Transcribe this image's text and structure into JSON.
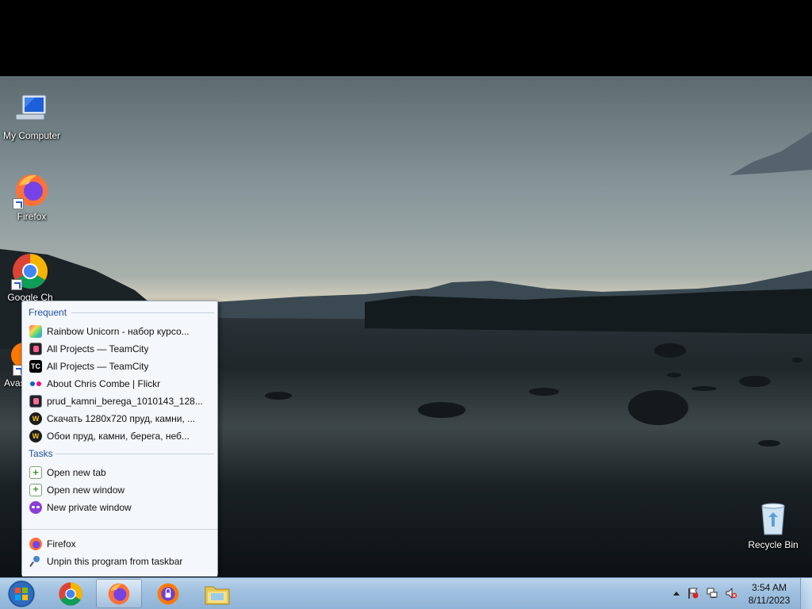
{
  "desktop": {
    "icons": [
      {
        "label": "My Computer"
      },
      {
        "label": "Firefox"
      },
      {
        "label": "Google Ch"
      },
      {
        "label": "Avas Br"
      },
      {
        "label": "Recycle Bin"
      }
    ]
  },
  "jumplist": {
    "frequent_heading": "Frequent",
    "frequent": [
      {
        "label": "Rainbow Unicorn - набор курсо...",
        "icon": "rainbow-unicorn-icon"
      },
      {
        "label": "All Projects — TeamCity",
        "icon": "teamcity-icon"
      },
      {
        "label": "All Projects — TeamCity",
        "icon": "teamcity-tc-icon"
      },
      {
        "label": "About Chris Combe | Flickr",
        "icon": "flickr-icon"
      },
      {
        "label": "prud_kamni_berega_1010143_128...",
        "icon": "image-file-icon"
      },
      {
        "label": "Скачать 1280x720 пруд, камни, ...",
        "icon": "wallpaper-site-icon"
      },
      {
        "label": "Обои пруд, камни, берега, неб...",
        "icon": "wallpaper-site-icon"
      }
    ],
    "tasks_heading": "Tasks",
    "tasks": [
      {
        "label": "Open new tab",
        "icon": "new-tab-icon"
      },
      {
        "label": "Open new window",
        "icon": "new-window-icon"
      },
      {
        "label": "New private window",
        "icon": "private-window-icon"
      }
    ],
    "bottom": [
      {
        "label": "Firefox",
        "icon": "firefox-icon"
      },
      {
        "label": "Unpin this program from taskbar",
        "icon": "unpin-icon"
      }
    ]
  },
  "taskbar": {
    "clock_time": "3:54 AM",
    "clock_date": "8/11/2023"
  },
  "colors": {
    "taskbar": "#9fc0df",
    "jumplist_heading": "#1e4f9e",
    "jumplist_bg": "#f4f7fb"
  }
}
